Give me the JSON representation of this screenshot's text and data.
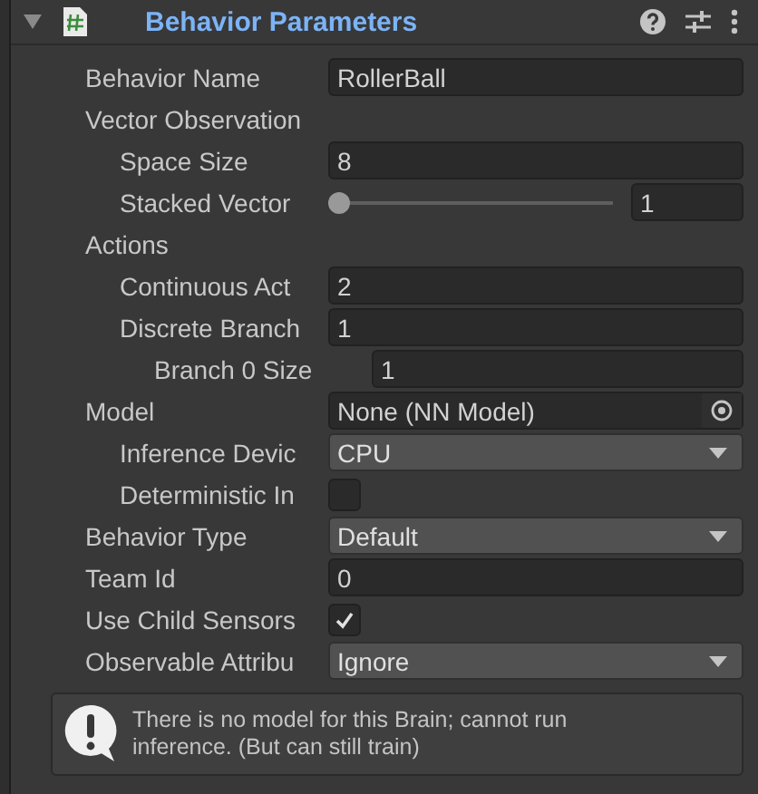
{
  "header": {
    "title": "Behavior Parameters",
    "expanded": true
  },
  "fields": [
    {
      "kind": "text",
      "label": "Behavior Name",
      "value": "RollerBall"
    },
    {
      "kind": "group",
      "label": "Vector Observation",
      "children": [
        {
          "kind": "text",
          "label": "Space Size",
          "value": "8"
        },
        {
          "kind": "slider",
          "label": "Stacked Vector",
          "level": 0,
          "value": "1"
        }
      ]
    },
    {
      "kind": "group",
      "label": "Actions",
      "children": [
        {
          "kind": "text",
          "label": "Continuous Act",
          "value": "2"
        },
        {
          "kind": "text",
          "label": "Discrete Branch",
          "value": "1",
          "children": [
            {
              "kind": "text",
              "label": "Branch 0 Size",
              "value": "1"
            }
          ]
        }
      ]
    },
    {
      "kind": "object",
      "label": "Model",
      "value": "None (NN Model)",
      "children": [
        {
          "kind": "dropdown",
          "label": "Inference Devic",
          "value": "CPU"
        },
        {
          "kind": "checkbox",
          "label": "Deterministic In",
          "checked": false
        }
      ]
    },
    {
      "kind": "dropdown",
      "label": "Behavior Type",
      "value": "Default"
    },
    {
      "kind": "text",
      "label": "Team Id",
      "value": "0"
    },
    {
      "kind": "checkbox",
      "label": "Use Child Sensors",
      "checked": true
    },
    {
      "kind": "dropdown",
      "label": "Observable Attribu",
      "value": "Ignore"
    }
  ],
  "help": {
    "message": "There is no model for this Brain; cannot run inference. (But can still train)"
  }
}
